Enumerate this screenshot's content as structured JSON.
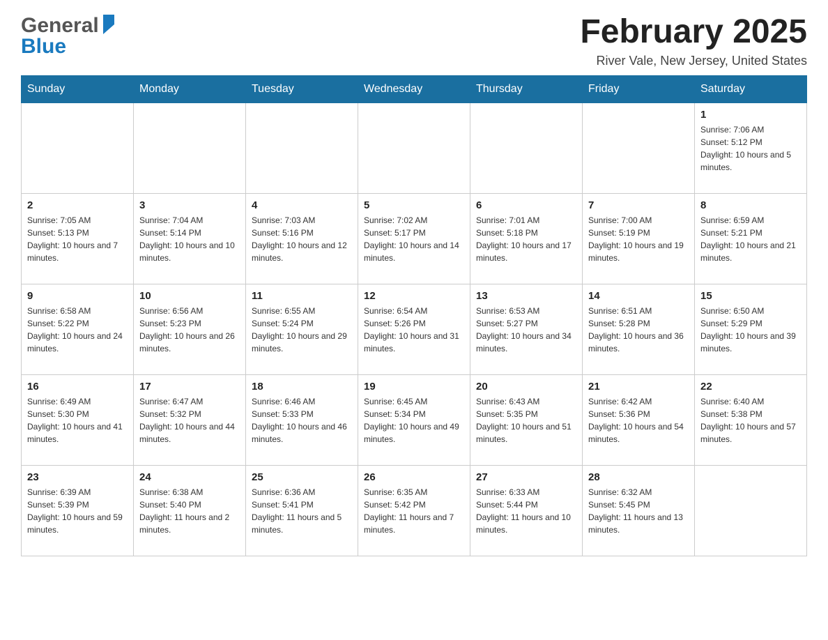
{
  "header": {
    "logo": {
      "general_text": "General",
      "blue_text": "Blue"
    },
    "title": "February 2025",
    "location": "River Vale, New Jersey, United States"
  },
  "calendar": {
    "days_of_week": [
      "Sunday",
      "Monday",
      "Tuesday",
      "Wednesday",
      "Thursday",
      "Friday",
      "Saturday"
    ],
    "weeks": [
      [
        {
          "day": "",
          "info": ""
        },
        {
          "day": "",
          "info": ""
        },
        {
          "day": "",
          "info": ""
        },
        {
          "day": "",
          "info": ""
        },
        {
          "day": "",
          "info": ""
        },
        {
          "day": "",
          "info": ""
        },
        {
          "day": "1",
          "info": "Sunrise: 7:06 AM\nSunset: 5:12 PM\nDaylight: 10 hours and 5 minutes."
        }
      ],
      [
        {
          "day": "2",
          "info": "Sunrise: 7:05 AM\nSunset: 5:13 PM\nDaylight: 10 hours and 7 minutes."
        },
        {
          "day": "3",
          "info": "Sunrise: 7:04 AM\nSunset: 5:14 PM\nDaylight: 10 hours and 10 minutes."
        },
        {
          "day": "4",
          "info": "Sunrise: 7:03 AM\nSunset: 5:16 PM\nDaylight: 10 hours and 12 minutes."
        },
        {
          "day": "5",
          "info": "Sunrise: 7:02 AM\nSunset: 5:17 PM\nDaylight: 10 hours and 14 minutes."
        },
        {
          "day": "6",
          "info": "Sunrise: 7:01 AM\nSunset: 5:18 PM\nDaylight: 10 hours and 17 minutes."
        },
        {
          "day": "7",
          "info": "Sunrise: 7:00 AM\nSunset: 5:19 PM\nDaylight: 10 hours and 19 minutes."
        },
        {
          "day": "8",
          "info": "Sunrise: 6:59 AM\nSunset: 5:21 PM\nDaylight: 10 hours and 21 minutes."
        }
      ],
      [
        {
          "day": "9",
          "info": "Sunrise: 6:58 AM\nSunset: 5:22 PM\nDaylight: 10 hours and 24 minutes."
        },
        {
          "day": "10",
          "info": "Sunrise: 6:56 AM\nSunset: 5:23 PM\nDaylight: 10 hours and 26 minutes."
        },
        {
          "day": "11",
          "info": "Sunrise: 6:55 AM\nSunset: 5:24 PM\nDaylight: 10 hours and 29 minutes."
        },
        {
          "day": "12",
          "info": "Sunrise: 6:54 AM\nSunset: 5:26 PM\nDaylight: 10 hours and 31 minutes."
        },
        {
          "day": "13",
          "info": "Sunrise: 6:53 AM\nSunset: 5:27 PM\nDaylight: 10 hours and 34 minutes."
        },
        {
          "day": "14",
          "info": "Sunrise: 6:51 AM\nSunset: 5:28 PM\nDaylight: 10 hours and 36 minutes."
        },
        {
          "day": "15",
          "info": "Sunrise: 6:50 AM\nSunset: 5:29 PM\nDaylight: 10 hours and 39 minutes."
        }
      ],
      [
        {
          "day": "16",
          "info": "Sunrise: 6:49 AM\nSunset: 5:30 PM\nDaylight: 10 hours and 41 minutes."
        },
        {
          "day": "17",
          "info": "Sunrise: 6:47 AM\nSunset: 5:32 PM\nDaylight: 10 hours and 44 minutes."
        },
        {
          "day": "18",
          "info": "Sunrise: 6:46 AM\nSunset: 5:33 PM\nDaylight: 10 hours and 46 minutes."
        },
        {
          "day": "19",
          "info": "Sunrise: 6:45 AM\nSunset: 5:34 PM\nDaylight: 10 hours and 49 minutes."
        },
        {
          "day": "20",
          "info": "Sunrise: 6:43 AM\nSunset: 5:35 PM\nDaylight: 10 hours and 51 minutes."
        },
        {
          "day": "21",
          "info": "Sunrise: 6:42 AM\nSunset: 5:36 PM\nDaylight: 10 hours and 54 minutes."
        },
        {
          "day": "22",
          "info": "Sunrise: 6:40 AM\nSunset: 5:38 PM\nDaylight: 10 hours and 57 minutes."
        }
      ],
      [
        {
          "day": "23",
          "info": "Sunrise: 6:39 AM\nSunset: 5:39 PM\nDaylight: 10 hours and 59 minutes."
        },
        {
          "day": "24",
          "info": "Sunrise: 6:38 AM\nSunset: 5:40 PM\nDaylight: 11 hours and 2 minutes."
        },
        {
          "day": "25",
          "info": "Sunrise: 6:36 AM\nSunset: 5:41 PM\nDaylight: 11 hours and 5 minutes."
        },
        {
          "day": "26",
          "info": "Sunrise: 6:35 AM\nSunset: 5:42 PM\nDaylight: 11 hours and 7 minutes."
        },
        {
          "day": "27",
          "info": "Sunrise: 6:33 AM\nSunset: 5:44 PM\nDaylight: 11 hours and 10 minutes."
        },
        {
          "day": "28",
          "info": "Sunrise: 6:32 AM\nSunset: 5:45 PM\nDaylight: 11 hours and 13 minutes."
        },
        {
          "day": "",
          "info": ""
        }
      ]
    ]
  }
}
